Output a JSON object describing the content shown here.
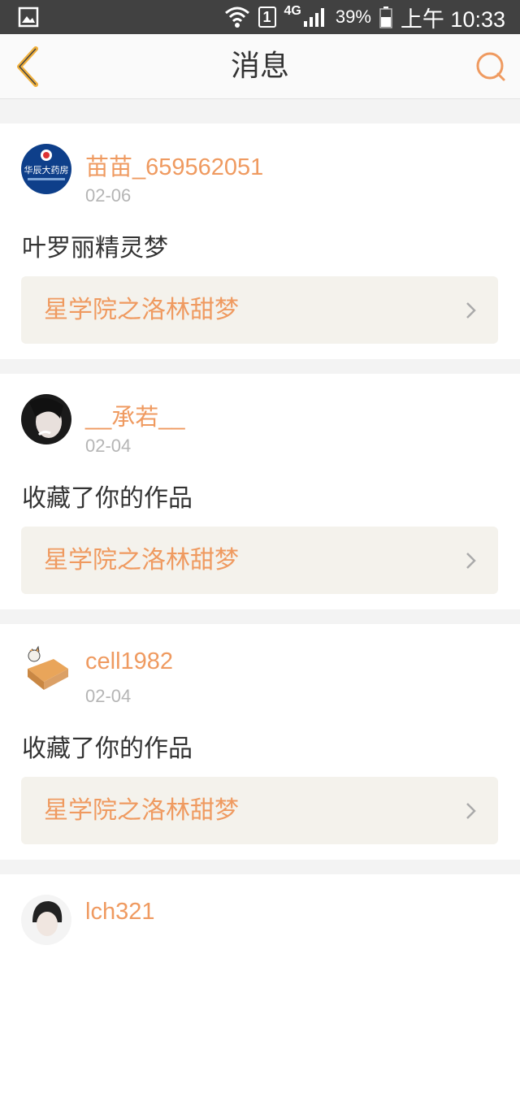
{
  "status_bar": {
    "sim": "1",
    "network": "4G",
    "battery": "39%",
    "time": "上午 10:33"
  },
  "header": {
    "title": "消息",
    "back_icon": "chevron-left-icon",
    "search_icon": "search-icon"
  },
  "messages": [
    {
      "username": "苗苗_659562051",
      "date": "02-06",
      "text": "叶罗丽精灵梦",
      "work_title": "星学院之洛林甜梦",
      "avatar_text": "华辰大药房"
    },
    {
      "username": "__承若__",
      "date": "02-04",
      "text": "收藏了你的作品",
      "work_title": "星学院之洛林甜梦"
    },
    {
      "username": "cell1982",
      "date": "02-04",
      "text": "收藏了你的作品",
      "work_title": "星学院之洛林甜梦"
    },
    {
      "username": "lch321"
    }
  ],
  "colors": {
    "accent": "#ef9a60",
    "status_bar": "#414141",
    "work_bg": "#f4f2ec"
  }
}
